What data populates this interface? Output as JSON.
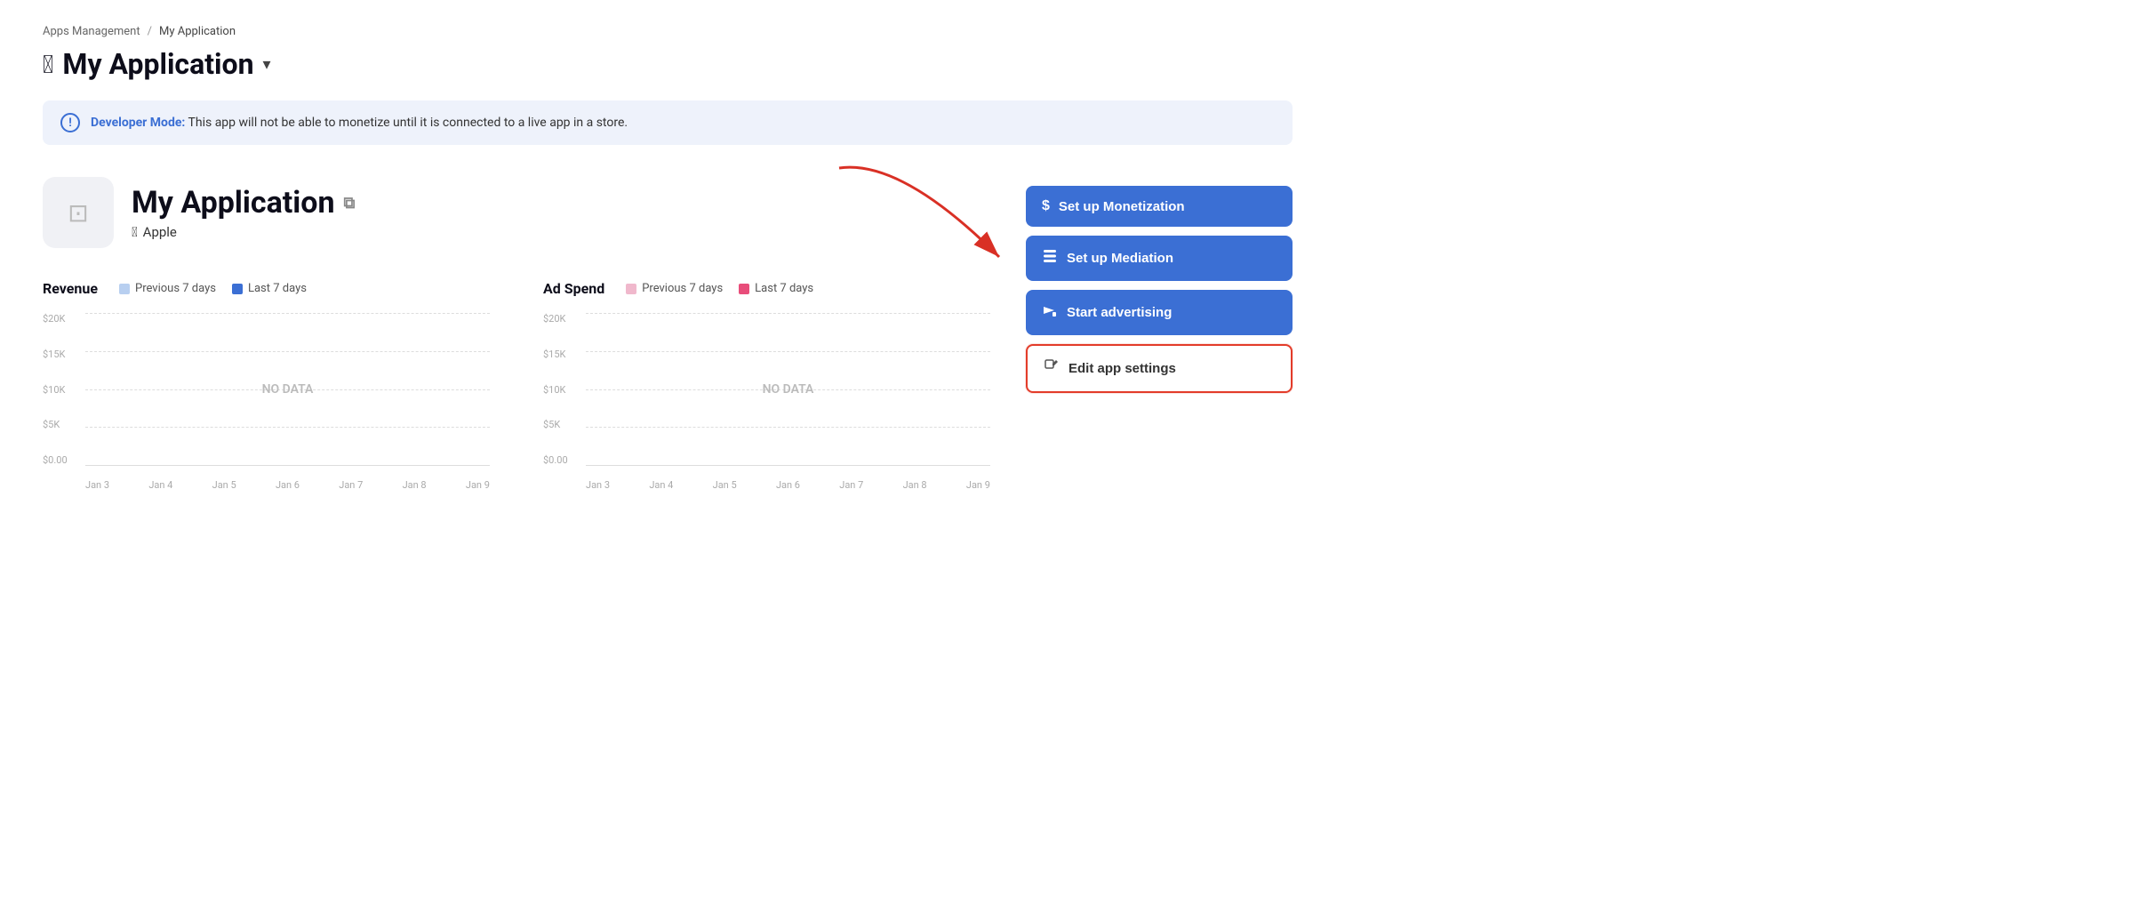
{
  "breadcrumb": {
    "parent_label": "Apps Management",
    "separator": "/",
    "current_label": "My Application"
  },
  "page_title": {
    "apple_icon": "",
    "title": "My Application",
    "chevron": "▾"
  },
  "dev_banner": {
    "icon_text": "!",
    "bold_text": "Developer Mode:",
    "message": " This app will not be able to monetize until it is connected to a live app in a store."
  },
  "app_info": {
    "name": "My Application",
    "platform": "Apple",
    "external_link_icon": "⬔"
  },
  "charts": {
    "revenue": {
      "title": "Revenue",
      "legend": [
        {
          "label": "Previous 7 days",
          "color": "#b8cff0"
        },
        {
          "label": "Last 7 days",
          "color": "#3b6fd4"
        }
      ],
      "y_labels": [
        "$20K",
        "$15K",
        "$10K",
        "$5K",
        "$0.00"
      ],
      "x_labels": [
        "Jan 3",
        "Jan 4",
        "Jan 5",
        "Jan 6",
        "Jan 7",
        "Jan 8",
        "Jan 9"
      ],
      "no_data": "NO DATA"
    },
    "ad_spend": {
      "title": "Ad Spend",
      "legend": [
        {
          "label": "Previous 7 days",
          "color": "#f0b8cc"
        },
        {
          "label": "Last 7 days",
          "color": "#e84d7a"
        }
      ],
      "y_labels": [
        "$20K",
        "$15K",
        "$10K",
        "$5K",
        "$0.00"
      ],
      "x_labels": [
        "Jan 3",
        "Jan 4",
        "Jan 5",
        "Jan 6",
        "Jan 7",
        "Jan 8",
        "Jan 9"
      ],
      "no_data": "NO DATA"
    }
  },
  "actions": {
    "monetization_label": "Set up Monetization",
    "mediation_label": "Set up Mediation",
    "advertising_label": "Start advertising",
    "edit_settings_label": "Edit app settings"
  }
}
